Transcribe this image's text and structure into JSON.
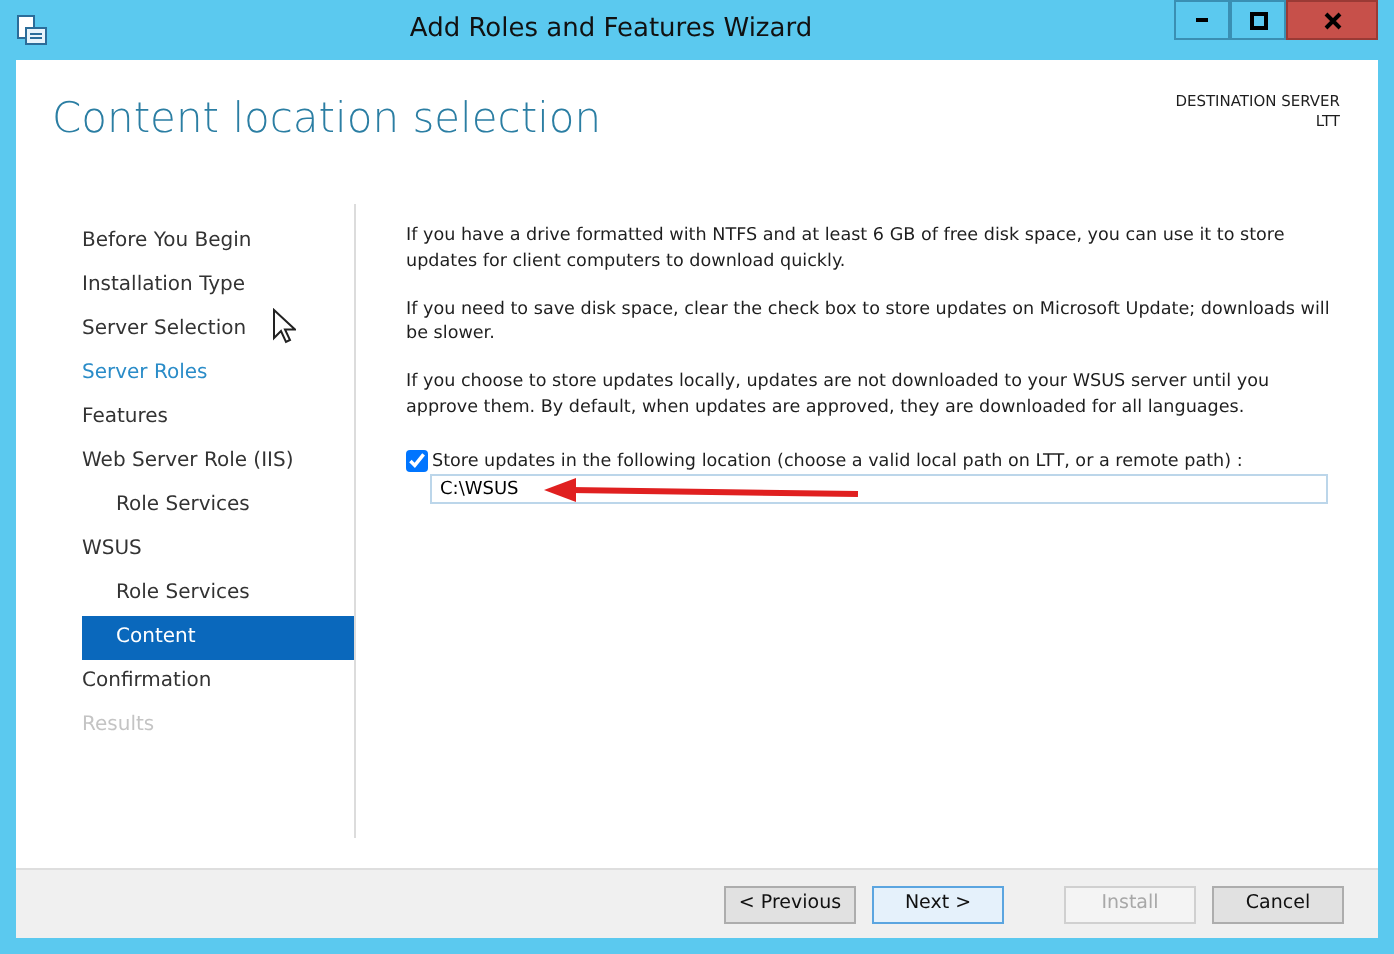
{
  "window": {
    "title": "Add Roles and Features Wizard",
    "controls": [
      {
        "kind": "minimize"
      },
      {
        "kind": "maximize"
      },
      {
        "kind": "close"
      }
    ]
  },
  "header": {
    "title": "Content location selection",
    "server_label": "DESTINATION SERVER",
    "server_name": "LTT"
  },
  "steps": [
    {
      "label": "Before You Begin",
      "selected": false,
      "disabled": false,
      "link": false
    },
    {
      "label": "Installation Type",
      "selected": false,
      "disabled": false,
      "link": false
    },
    {
      "label": "Server Selection",
      "selected": false,
      "disabled": false,
      "link": false
    },
    {
      "label": "Server Roles",
      "selected": false,
      "disabled": false,
      "link": true
    },
    {
      "label": "Features",
      "selected": false,
      "disabled": false,
      "link": false
    },
    {
      "label": "Web Server Role (IIS)",
      "selected": false,
      "disabled": false,
      "link": false,
      "children": [
        {
          "label": "Role Services",
          "selected": false,
          "disabled": false,
          "link": false
        }
      ]
    },
    {
      "label": "WSUS",
      "selected": false,
      "disabled": false,
      "link": false,
      "children": [
        {
          "label": "Role Services",
          "selected": false,
          "disabled": false,
          "link": false
        },
        {
          "label": "Content",
          "selected": true,
          "disabled": false,
          "link": false
        }
      ]
    },
    {
      "label": "Confirmation",
      "selected": false,
      "disabled": false,
      "link": false
    },
    {
      "label": "Results",
      "selected": false,
      "disabled": true,
      "link": false
    }
  ],
  "paragraphs": [
    "If you have a drive formatted with NTFS and at least 6 GB of free disk space, you can use it to store updates for client computers to download quickly.",
    "If you need to save disk space, clear the check box to store updates on Microsoft Update; downloads will be slower.",
    "If you choose to store updates locally, updates are not downloaded to your WSUS server until you approve them. By default, when updates are approved, they are downloaded for all languages."
  ],
  "store_option": {
    "label": "Store updates in the following location (choose a valid local path on LTT, or a remote path) :",
    "checked": true,
    "path": "C:\\WSUS"
  },
  "buttons": [
    {
      "label": "< Previous",
      "disabled": false,
      "default": false
    },
    {
      "label": "Next >",
      "disabled": false,
      "default": true
    },
    {
      "label": "Install",
      "disabled": true,
      "default": false
    },
    {
      "label": "Cancel",
      "disabled": false,
      "default": false
    }
  ]
}
